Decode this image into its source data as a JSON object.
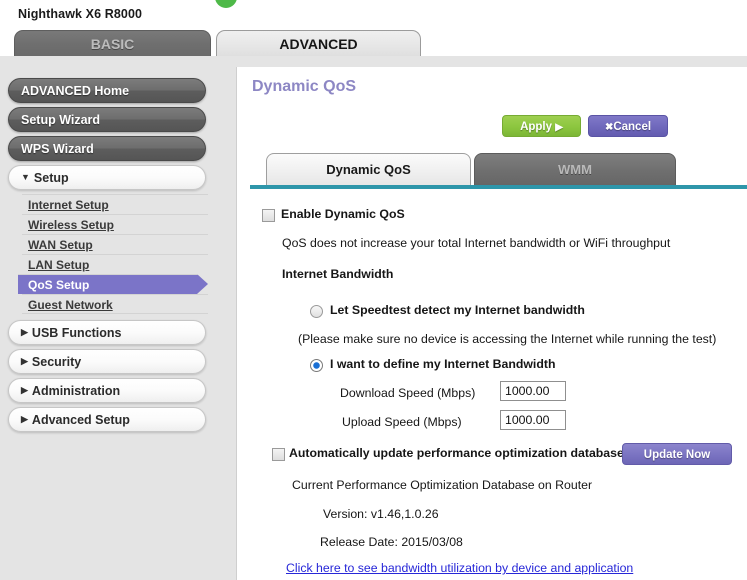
{
  "header": {
    "model": "Nighthawk X6 R8000",
    "logo_color": "#4eb948"
  },
  "top_tabs": [
    {
      "label": "BASIC",
      "active": false
    },
    {
      "label": "ADVANCED",
      "active": true
    }
  ],
  "sidebar": {
    "buttons": [
      {
        "label": "ADVANCED Home",
        "style": "dark"
      },
      {
        "label": "Setup Wizard",
        "style": "dark"
      },
      {
        "label": "WPS Wizard",
        "style": "dark"
      }
    ],
    "setup_group": {
      "label": "Setup",
      "caret": "▼",
      "expanded": true
    },
    "sub_items": [
      {
        "label": "Internet Setup",
        "selected": false
      },
      {
        "label": "Wireless Setup",
        "selected": false
      },
      {
        "label": "WAN Setup",
        "selected": false
      },
      {
        "label": "LAN Setup",
        "selected": false
      },
      {
        "label": "QoS Setup",
        "selected": true
      },
      {
        "label": "Guest Network",
        "selected": false
      }
    ],
    "collapsed_groups": [
      {
        "label": "USB Functions",
        "caret": "▶"
      },
      {
        "label": "Security",
        "caret": "▶"
      },
      {
        "label": "Administration",
        "caret": "▶"
      },
      {
        "label": "Advanced Setup",
        "caret": "▶"
      }
    ],
    "selected_color": "#7b74c8"
  },
  "content": {
    "title": "Dynamic QoS",
    "title_color": "#8d87c4",
    "buttons": {
      "apply_label": "Apply",
      "apply_icon": "▶",
      "apply_color": "#8cc63f",
      "cancel_label": "Cancel",
      "cancel_icon": "✖",
      "cancel_color": "#6f68bc"
    },
    "sub_tabs": [
      {
        "label": "Dynamic QoS",
        "active": true
      },
      {
        "label": "WMM",
        "active": false
      }
    ],
    "rule_color": "#2e96aa",
    "enable_qos": {
      "label": "Enable Dynamic QoS",
      "checked": false
    },
    "note_throughput": "QoS does not increase your total Internet bandwidth or WiFi throughput",
    "internet_bandwidth_heading": "Internet Bandwidth",
    "bandwidth_options": [
      {
        "label": "Let Speedtest detect my Internet bandwidth",
        "selected": false
      },
      {
        "label": "I want to define my Internet Bandwidth",
        "selected": true
      }
    ],
    "note_speedtest": "(Please make sure no device is accessing the Internet while running the test)",
    "speed_fields": [
      {
        "label": "Download Speed (Mbps)",
        "value": "1000.00"
      },
      {
        "label": "Upload Speed (Mbps)",
        "value": "1000.00"
      }
    ],
    "auto_update": {
      "label": "Automatically update performance optimization database",
      "checked": false,
      "button_label": "Update Now"
    },
    "database_heading": "Current Performance Optimization Database on Router",
    "database_version": "Version: v1.46,1.0.26",
    "database_release_date": "Release Date: 2015/03/08",
    "bandwidth_link": "Click here to see bandwidth utilization by device and application"
  }
}
